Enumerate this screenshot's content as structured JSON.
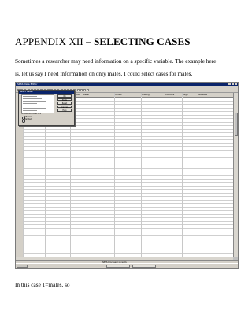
{
  "heading": {
    "prefix": "APPENDIX XII – ",
    "emphasis": "SELECTING CASES"
  },
  "paragraphs": {
    "p1": "Sometimes a researcher may need information on a specific variable.  The example here",
    "p2": "is, let us say I need information on only males. I could select cases for males.",
    "p3": "In this case 1=males, so"
  },
  "screenshot": {
    "window_title": "SPSS Data Editor",
    "column_headers": [
      "Name",
      "Type",
      "Width",
      "Decimals",
      "Label",
      "Values",
      "Missing",
      "Columns",
      "Align",
      "Measure"
    ],
    "dialog": {
      "title": "Select Cases",
      "buttons": [
        "OK",
        "Paste",
        "Reset",
        "Cancel",
        "Help"
      ],
      "options": [
        "All cases",
        "If condition is satisfied",
        "Random sample of cases",
        "Based on time or case range",
        "Use filter variable"
      ],
      "unselected_label": "Unselected Cases Are",
      "unselected_options": [
        "Filtered",
        "Deleted"
      ]
    },
    "status_text": "SPSS Processor is ready",
    "taskbar_items": [
      "Start",
      "SPSS Data Editor",
      "Document"
    ]
  }
}
